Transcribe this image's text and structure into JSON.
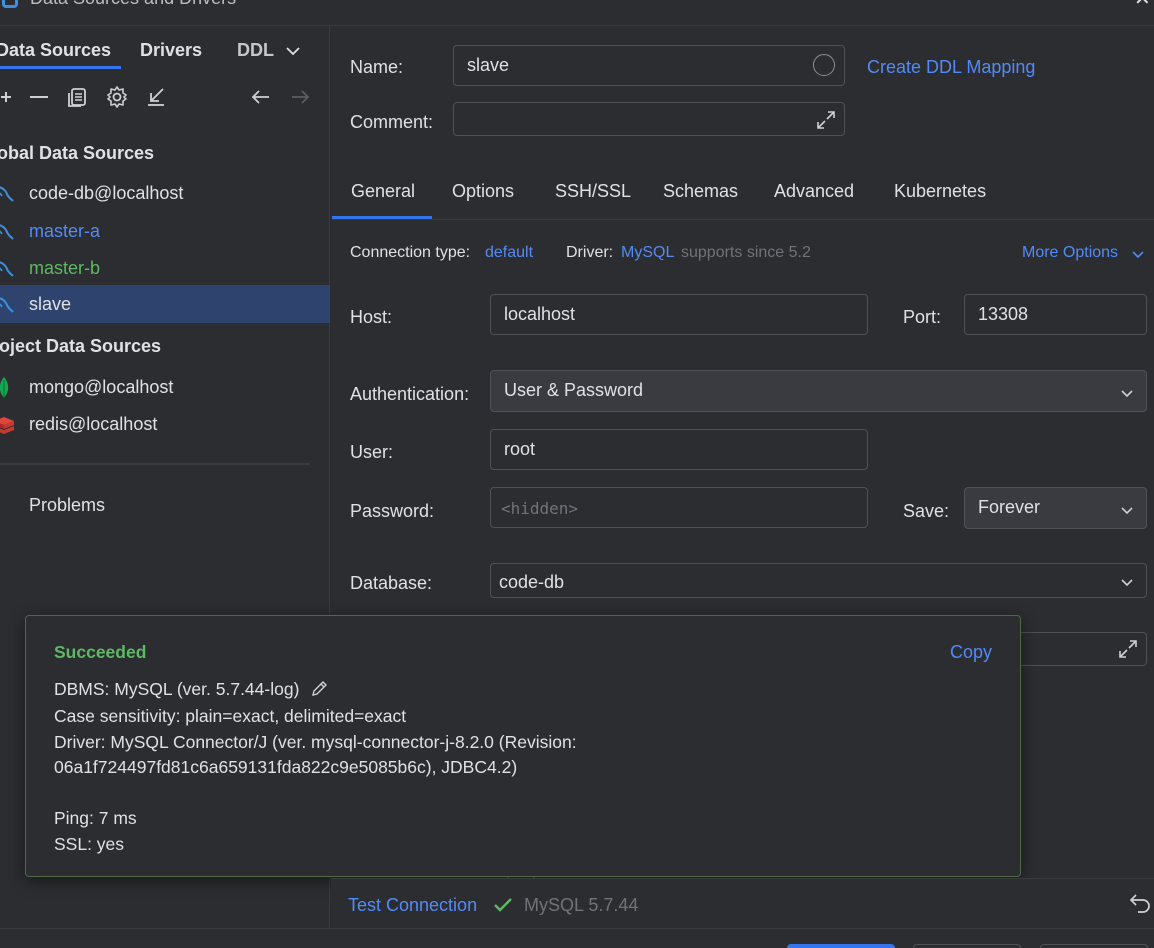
{
  "window": {
    "title": "Data Sources and Drivers"
  },
  "left": {
    "tabs": [
      "Data Sources",
      "Drivers",
      "DDL"
    ],
    "global_section": "lobal Data Sources",
    "project_section": "roject Data Sources",
    "global_items": [
      {
        "label": "code-db@localhost",
        "color": "#dfe1e5",
        "icon": "mysql-dolphin-icon"
      },
      {
        "label": "master-a",
        "color": "#548af7",
        "icon": "mysql-dolphin-icon"
      },
      {
        "label": "master-b",
        "color": "#5fb865",
        "icon": "mysql-dolphin-icon"
      },
      {
        "label": "slave",
        "color": "#dfe1e5",
        "icon": "mysql-dolphin-icon"
      }
    ],
    "project_items": [
      {
        "label": "mongo@localhost",
        "icon": "mongodb-leaf-icon"
      },
      {
        "label": "redis@localhost",
        "icon": "redis-icon"
      }
    ],
    "problems_label": "Problems"
  },
  "form": {
    "name_label": "Name:",
    "name_value": "slave",
    "comment_label": "Comment:",
    "create_ddl_link": "Create DDL Mapping",
    "tabs": [
      "General",
      "Options",
      "SSH/SSL",
      "Schemas",
      "Advanced",
      "Kubernetes"
    ],
    "connection_type_label": "Connection type:",
    "connection_type_value": "default",
    "driver_label": "Driver:",
    "driver_value": "MySQL",
    "driver_note": "supports since 5.2",
    "more_options": "More Options",
    "host_label": "Host:",
    "host_value": "localhost",
    "port_label": "Port:",
    "port_value": "13308",
    "auth_label": "Authentication:",
    "auth_value": "User & Password",
    "user_label": "User:",
    "user_value": "root",
    "password_label": "Password:",
    "password_placeholder": "<hidden>",
    "save_label": "Save:",
    "save_value": "Forever",
    "database_label": "Database:",
    "database_value": "code-db"
  },
  "popup": {
    "status": "Succeeded",
    "copy": "Copy",
    "dbms": "DBMS: MySQL (ver. 5.7.44-log)",
    "case": "Case sensitivity: plain=exact, delimited=exact",
    "driver_line1": "Driver: MySQL Connector/J (ver. mysql-connector-j-8.2.0 (Revision:",
    "driver_line2": "06a1f724497fd81c6a659131fda822c9e5085b6c), JDBC4.2)",
    "ping": "Ping: 7 ms",
    "ssl": "SSL: yes"
  },
  "bottom": {
    "test_connection": "Test Connection",
    "result": "MySQL 5.7.44"
  },
  "colors": {
    "accent": "#548af7",
    "success": "#5fb865",
    "selection": "#2e436e",
    "background": "#2b2d30"
  }
}
